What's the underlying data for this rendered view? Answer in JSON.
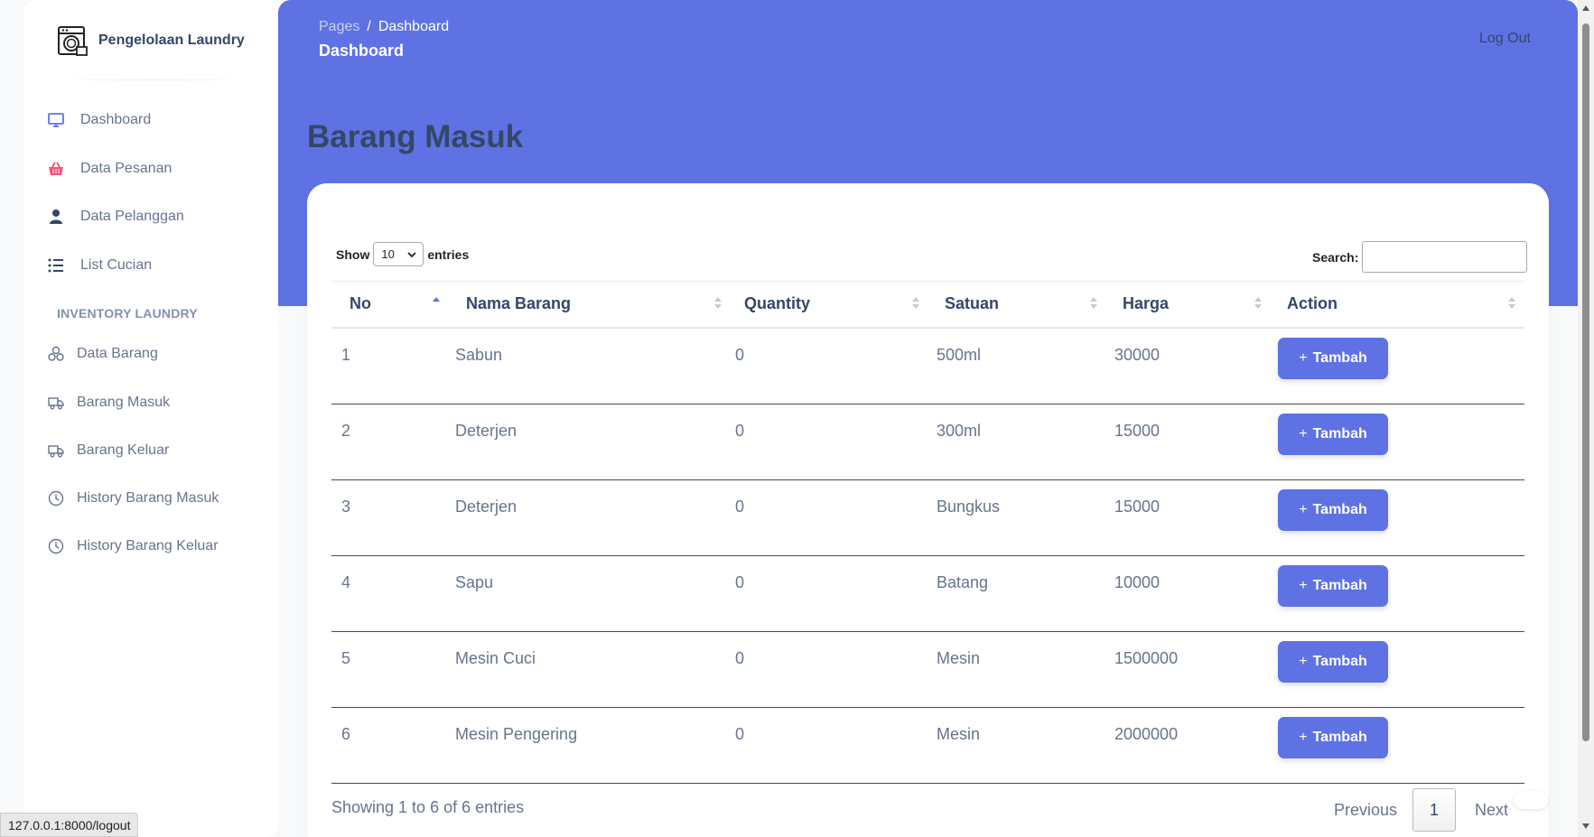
{
  "sidebar": {
    "brand": "Pengelolaan Laundry",
    "menu": [
      {
        "label": "Dashboard",
        "icon": "monitor-icon",
        "color": "#5e72e4"
      },
      {
        "label": "Data Pesanan",
        "icon": "basket-icon",
        "color": "#f5365c"
      },
      {
        "label": "Data Pelanggan",
        "icon": "user-icon",
        "color": "#344767"
      },
      {
        "label": "List Cucian",
        "icon": "list-icon",
        "color": "#344767"
      }
    ],
    "section_heading": "INVENTORY LAUNDRY",
    "inventory": [
      {
        "label": "Data Barang",
        "icon": "box-cluster-icon"
      },
      {
        "label": "Barang Masuk",
        "icon": "truck-icon"
      },
      {
        "label": "Barang Keluar",
        "icon": "truck-icon"
      },
      {
        "label": "History Barang Masuk",
        "icon": "clock-icon"
      },
      {
        "label": "History Barang Keluar",
        "icon": "clock-icon"
      }
    ]
  },
  "header": {
    "breadcrumb_root": "Pages",
    "breadcrumb_sep": "/",
    "breadcrumb_current": "Dashboard",
    "title": "Dashboard",
    "logout": "Log Out"
  },
  "page_title": "Barang Masuk",
  "table_controls": {
    "show_label": "Show",
    "page_size": "10",
    "entries_label": "entries",
    "search_label": "Search:",
    "search_value": ""
  },
  "columns": [
    "No",
    "Nama Barang",
    "Quantity",
    "Satuan",
    "Harga",
    "Action"
  ],
  "rows": [
    {
      "no": "1",
      "nama": "Sabun",
      "qty": "0",
      "satuan": "500ml",
      "harga": "30000",
      "action": "Tambah"
    },
    {
      "no": "2",
      "nama": "Deterjen",
      "qty": "0",
      "satuan": "300ml",
      "harga": "15000",
      "action": "Tambah"
    },
    {
      "no": "3",
      "nama": "Deterjen",
      "qty": "0",
      "satuan": "Bungkus",
      "harga": "15000",
      "action": "Tambah"
    },
    {
      "no": "4",
      "nama": "Sapu",
      "qty": "0",
      "satuan": "Batang",
      "harga": "10000",
      "action": "Tambah"
    },
    {
      "no": "5",
      "nama": "Mesin Cuci",
      "qty": "0",
      "satuan": "Mesin",
      "harga": "1500000",
      "action": "Tambah"
    },
    {
      "no": "6",
      "nama": "Mesin Pengering",
      "qty": "0",
      "satuan": "Mesin",
      "harga": "2000000",
      "action": "Tambah"
    }
  ],
  "footer": {
    "info": "Showing 1 to 6 of 6 entries",
    "previous": "Previous",
    "page": "1",
    "next": "Next"
  },
  "status_bar": "127.0.0.1:8000/logout",
  "colors": {
    "primary": "#5e72e4",
    "text": "#344767",
    "muted": "#67748e"
  }
}
